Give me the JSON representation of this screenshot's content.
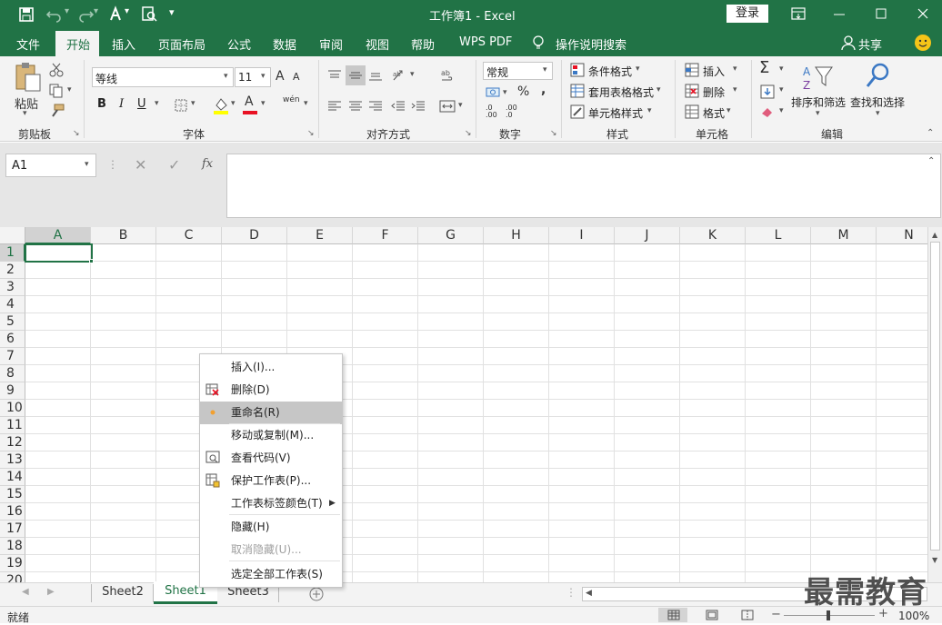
{
  "title": {
    "text": "工作簿1  -  Excel",
    "login": "登录"
  },
  "qat": {
    "save_icon": "save-icon",
    "undo_icon": "undo-icon",
    "redo_icon": "redo-icon",
    "touch_icon": "touch-mode-icon",
    "preview_icon": "print-preview-icon"
  },
  "tabs": [
    "文件",
    "开始",
    "插入",
    "页面布局",
    "公式",
    "数据",
    "审阅",
    "视图",
    "帮助",
    "WPS PDF"
  ],
  "active_tab": "开始",
  "tell_me": "操作说明搜索",
  "share": "共享",
  "clipboard": {
    "paste": "粘贴",
    "group": "剪贴板"
  },
  "font": {
    "name": "等线",
    "size": "11",
    "bold": "B",
    "italic": "I",
    "underline": "U",
    "group": "字体",
    "inc": "A",
    "dec": "A",
    "color": "A",
    "wen": "wén"
  },
  "align": {
    "group": "对齐方式"
  },
  "number": {
    "format": "常规",
    "percent": "%",
    "comma": ",",
    "group": "数字",
    "dec_inc": ".0 .00",
    "dec_dec": ".00 .0"
  },
  "styles": {
    "cond": "条件格式",
    "table": "套用表格格式",
    "cell": "单元格样式",
    "group": "样式"
  },
  "cells": {
    "insert": "插入",
    "delete": "删除",
    "format": "格式",
    "group": "单元格"
  },
  "editing": {
    "sort": "排序和筛选",
    "find": "查找和选择",
    "group": "编辑"
  },
  "formula_bar": {
    "namebox": "A1",
    "fx": "fx",
    "cancel": "✕",
    "enter": "✓"
  },
  "columns": [
    "A",
    "B",
    "C",
    "D",
    "E",
    "F",
    "G",
    "H",
    "I",
    "J",
    "K",
    "L",
    "M",
    "N"
  ],
  "rows": [
    "1",
    "2",
    "3",
    "4",
    "5",
    "6",
    "7",
    "8",
    "9",
    "10",
    "11",
    "12",
    "13",
    "14",
    "15",
    "16",
    "17",
    "18",
    "19",
    "20"
  ],
  "context_menu": [
    {
      "label": "插入(I)...",
      "icon": ""
    },
    {
      "label": "删除(D)",
      "icon": "delete-sheet-icon"
    },
    {
      "label": "重命名(R)",
      "icon": "rename-icon"
    },
    {
      "label": "移动或复制(M)...",
      "icon": ""
    },
    {
      "label": "查看代码(V)",
      "icon": "view-code-icon"
    },
    {
      "label": "保护工作表(P)...",
      "icon": "protect-sheet-icon"
    },
    {
      "label": "工作表标签颜色(T)",
      "icon": ""
    },
    {
      "label": "隐藏(H)",
      "icon": ""
    },
    {
      "label": "取消隐藏(U)...",
      "icon": ""
    },
    {
      "label": "选定全部工作表(S)",
      "icon": ""
    }
  ],
  "sheets": [
    "Sheet2",
    "Sheet1",
    "Sheet3"
  ],
  "active_sheet": "Sheet1",
  "status": {
    "ready": "就绪",
    "zoom": "100%",
    "minus": "−",
    "plus": "+"
  },
  "watermark": "最需教育",
  "colors": {
    "accent": "#217346",
    "selected_tab": "#ffffff"
  }
}
